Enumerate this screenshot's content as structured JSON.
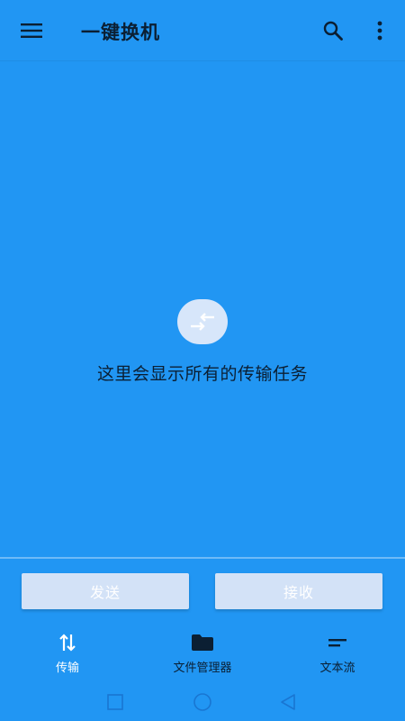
{
  "colors": {
    "background": "#2196F3",
    "button_bg": "#D3E2F7",
    "icon_circle": "#D7E6FA",
    "text_dark": "#0b1f33",
    "text_light": "#ffffff"
  },
  "header": {
    "title": "一键换机",
    "icons": [
      "menu-icon",
      "search-icon",
      "more-vert-icon"
    ]
  },
  "empty_state": {
    "icon": "swap-arrows-icon",
    "message": "这里会显示所有的传输任务"
  },
  "actions": {
    "send_label": "发送",
    "receive_label": "接收"
  },
  "bottom_nav": {
    "items": [
      {
        "label": "传输",
        "icon": "transfer-icon",
        "selected": true
      },
      {
        "label": "文件管理器",
        "icon": "folder-icon",
        "selected": false
      },
      {
        "label": "文本流",
        "icon": "text-lines-icon",
        "selected": false
      }
    ]
  },
  "system_nav": {
    "icons": [
      "recent-apps-icon",
      "home-icon",
      "back-icon"
    ]
  }
}
